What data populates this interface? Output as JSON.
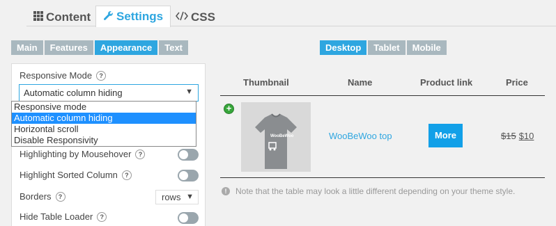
{
  "top_tabs": [
    {
      "icon": "grid-icon",
      "label": "Content"
    },
    {
      "icon": "wrench-icon",
      "label": "Settings"
    },
    {
      "icon": "code-icon",
      "label": "CSS"
    }
  ],
  "sub_tabs": [
    "Main",
    "Features",
    "Appearance",
    "Text"
  ],
  "active_sub_tab": "Appearance",
  "device_tabs": [
    "Desktop",
    "Tablet",
    "Mobile"
  ],
  "active_device_tab": "Desktop",
  "settings": {
    "responsive_mode_label": "Responsive Mode",
    "responsive_mode_value": "Automatic column hiding",
    "responsive_options": [
      "Responsive mode",
      "Automatic column hiding",
      "Horizontal scroll",
      "Disable Responsivity"
    ],
    "highlight_mouseover_label": "Highlighting by Mousehover",
    "highlight_sorted_label": "Highlight Sorted Column",
    "borders_label": "Borders",
    "borders_value": "rows",
    "hide_loader_label": "Hide Table Loader",
    "help_glyph": "?"
  },
  "preview": {
    "columns": [
      "Thumbnail",
      "Name",
      "Product link",
      "Price"
    ],
    "row": {
      "thumb_text": "WooBeWoo",
      "name": "WooBeWoo top",
      "link_button": "More",
      "old_price": "$15",
      "new_price": "$10"
    },
    "note": "Note that the table may look a little different depending on your theme style."
  },
  "colors": {
    "accent": "#2ea6e0",
    "tab_inactive": "#a9b8bf",
    "add_green": "#37a63b"
  }
}
